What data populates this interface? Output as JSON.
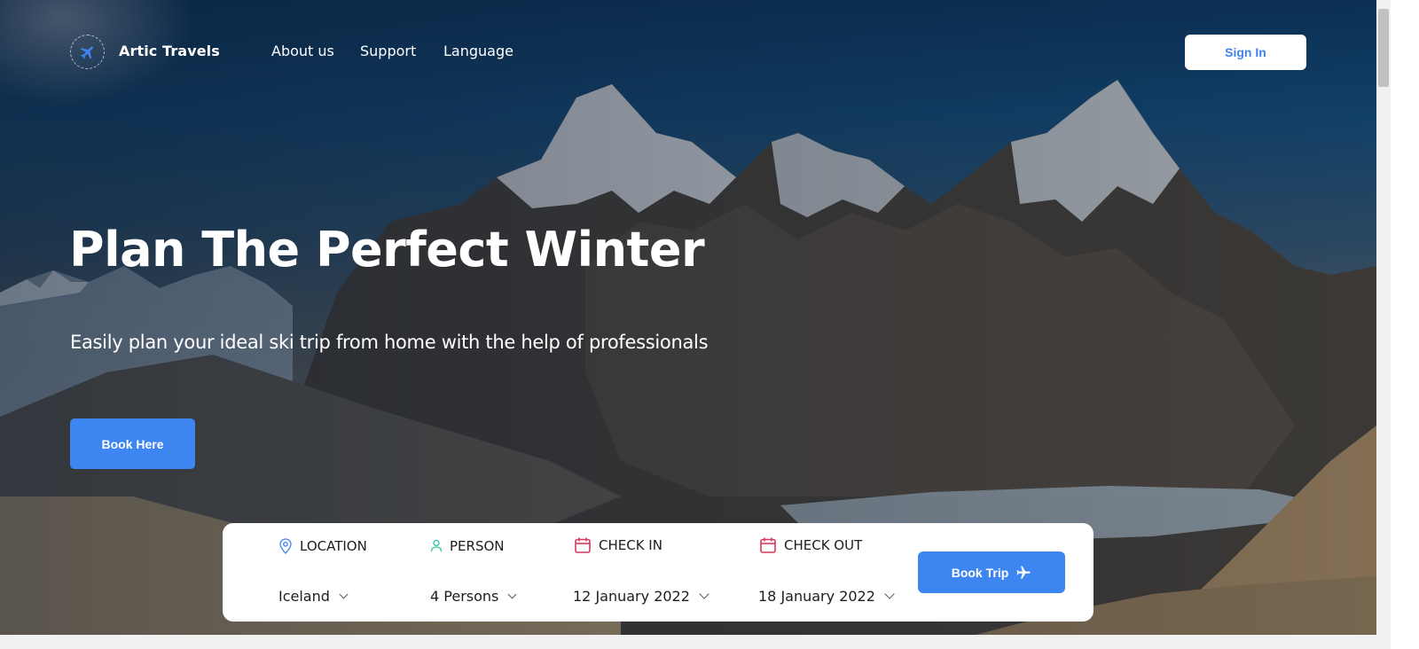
{
  "header": {
    "brand": "Artic Travels",
    "logo_icon": "airplane-icon",
    "nav": [
      {
        "label": "About us"
      },
      {
        "label": "Support"
      },
      {
        "label": "Language"
      }
    ],
    "signin_label": "Sign In"
  },
  "hero": {
    "title": "Plan The Perfect Winter",
    "subtitle": "Easily plan your ideal ski trip from home with the help of professionals",
    "cta_label": "Book Here"
  },
  "booking": {
    "fields": [
      {
        "label": "LOCATION",
        "icon": "location-pin-icon",
        "value": "Iceland"
      },
      {
        "label": "PERSON",
        "icon": "person-icon",
        "value": "4 Persons"
      },
      {
        "label": "CHECK IN",
        "icon": "calendar-icon",
        "value": "12 January 2022"
      },
      {
        "label": "CHECK OUT",
        "icon": "calendar-icon",
        "value": "18 January 2022"
      }
    ],
    "submit_label": "Book Trip",
    "submit_icon": "airplane-icon"
  },
  "colors": {
    "accent": "#3d85f0",
    "calendar_icon": "#d9385a",
    "person_icon": "#2ec4a0",
    "location_icon": "#3d85f0"
  }
}
